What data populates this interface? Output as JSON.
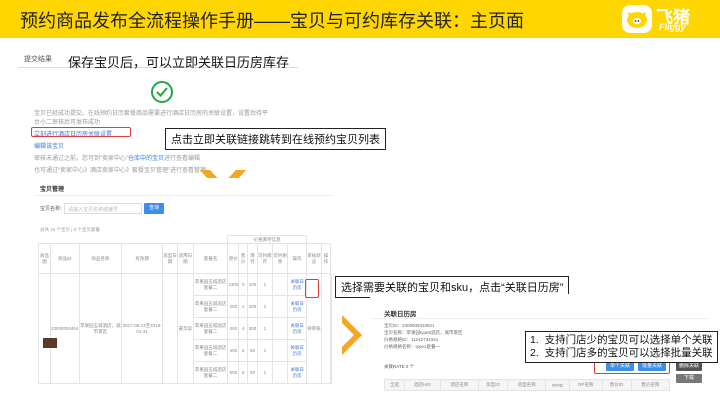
{
  "header": {
    "title": "预约商品发布全流程操作手册——宝贝与可约库存关联：主页面",
    "logo_cn": "飞猪",
    "logo_en": "Fliggy"
  },
  "panel1": {
    "tab": "提交结果",
    "caption": "保存宝贝后，可以立即关联日历房库存",
    "desc_line1": "宝贝已经成功提交。在线预约日历套餐商品需要进行酒店日历房的关联设置，设置后待平",
    "desc_line2": "台小二审核后可发布成功",
    "link1": "立刻进行酒店日历房关联设置",
    "link2": "编辑该宝贝",
    "note1_prefix": "审核未通过之前，您可到“卖家中心”",
    "note1_link": "仓库中的宝贝",
    "note1_suffix": "进行查看编辑",
    "note2": "也可通过“卖家中心》酒店卖家中心》套餐宝贝管理”进行查看管理"
  },
  "callout1": "点击立即关联链接跳转到在线预约宝贝列表",
  "panel2": {
    "title": "宝贝管理",
    "search_label": "宝贝名称：",
    "search_placeholder": "请输入宝贝名称或编号",
    "search_button": "查询",
    "summary": "总共 16 个宝贝 | 8 个宝贝套餐",
    "group_header": "价格库存信息",
    "columns": [
      "商品图",
      "商品ID",
      "商品名称",
      "有效期",
      "房型日期",
      "适用日期",
      "套餐名",
      "原价",
      "售价",
      "库存",
      "可约库存",
      "可约剩余",
      "操作",
      "审核状态",
      "操作"
    ],
    "item_id": "23009393404",
    "item_name": "苹果园五城酒店，城市景区",
    "date_range": "2017-06-13至2018-01-31",
    "room_type": "豪华房",
    "status": "待审核",
    "rows": [
      {
        "pkg": "苹果园五城酒店套餐二",
        "price": "2300",
        "sale": "0",
        "stock": "100",
        "avail": "1",
        "op": "关联日历房"
      },
      {
        "pkg": "苹果园五城酒店套餐二",
        "price": "200",
        "sale": "2",
        "stock": "200",
        "avail": "1",
        "op": "关联日历房"
      },
      {
        "pkg": "苹果园五城酒店套餐二",
        "price": "300",
        "sale": "4",
        "stock": "300",
        "avail": "1",
        "op": "关联日历房"
      },
      {
        "pkg": "苹果园五城酒店套餐二",
        "price": "400",
        "sale": "5",
        "stock": "50",
        "avail": "1",
        "op": "关联日历房"
      },
      {
        "pkg": "苹果园五城酒店套餐二",
        "price": "500",
        "sale": "6",
        "stock": "60",
        "avail": "1",
        "op": "关联日历房"
      }
    ]
  },
  "callout2": "选择需要关联的宝贝和sku，点击“关联日历房”",
  "panel3": {
    "title": "关联日历房",
    "info1": "宝贝ID：2300939310821",
    "info2": "宝贝名称：苹果园type5酒店，城市景区",
    "info3": "价格规格ID：11242734341",
    "info4": "价格规格名称：type1套餐一",
    "rate_label": "关联RATE 0 个",
    "btn_single": "单个关联",
    "btn_batch": "批量关联",
    "btn_delete": "删除关联",
    "btn_down": "下载",
    "columns": [
      "全选",
      "酒店HID",
      "酒店名称",
      "房型ID",
      "房型名称",
      "RPID",
      "RP名称",
      "售价ID",
      "售价名称"
    ]
  },
  "callout3": {
    "line1": "支持门店少的宝贝可以选择单个关联",
    "line2": "支持门店多的宝贝可以选择批量关联"
  },
  "colors": {
    "header_bg": "#ffd600",
    "accent_blue": "#3d8ee8",
    "highlight_red": "#e23b3b",
    "success_green": "#22a744",
    "arrow_orange": "#f5a623"
  }
}
